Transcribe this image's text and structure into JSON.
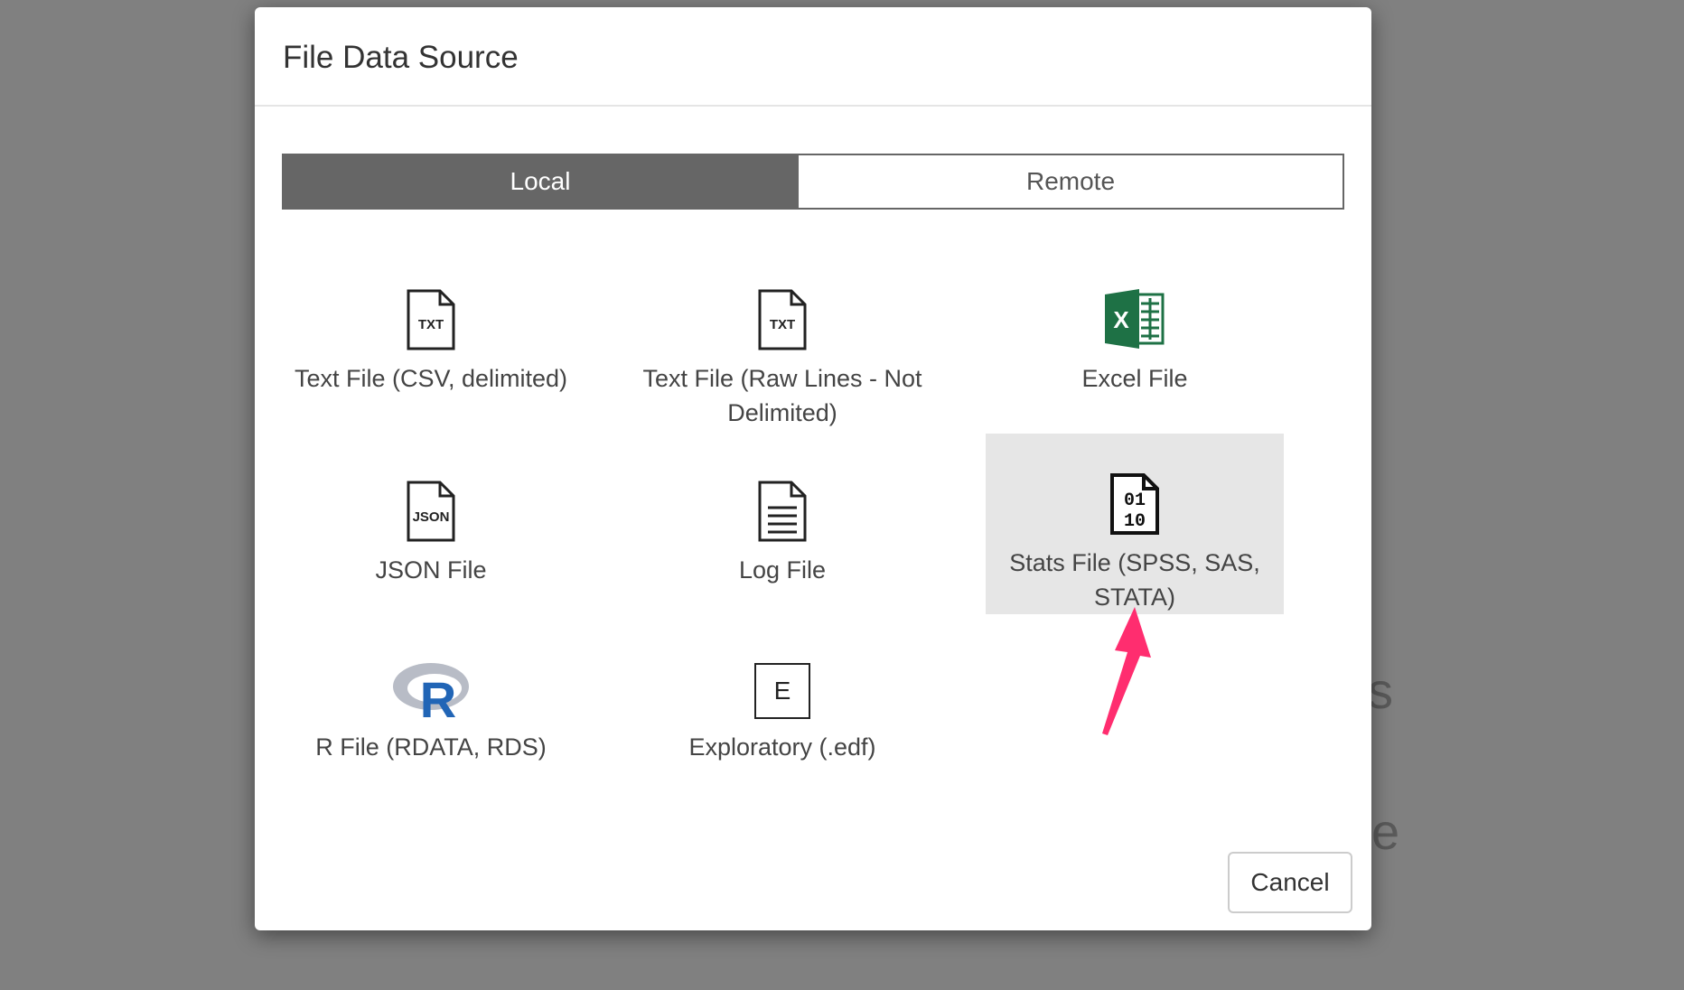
{
  "dialog": {
    "title": "File Data Source"
  },
  "tabs": [
    {
      "label": "Local",
      "active": true
    },
    {
      "label": "Remote",
      "active": false
    }
  ],
  "items": [
    {
      "label": "Text File (CSV, delimited)",
      "icon": "txt-file-icon"
    },
    {
      "label": "Text File (Raw Lines - Not Delimited)",
      "icon": "txt-file-icon"
    },
    {
      "label": "Excel File",
      "icon": "excel-icon"
    },
    {
      "label": "JSON File",
      "icon": "json-file-icon"
    },
    {
      "label": "Log File",
      "icon": "log-file-icon"
    },
    {
      "label": "Stats File (SPSS, SAS, STATA)",
      "icon": "binary-file-icon",
      "selected": true
    },
    {
      "label": "R File (RDATA, RDS)",
      "icon": "r-logo-icon"
    },
    {
      "label": "Exploratory (.edf)",
      "icon": "edf-icon",
      "icon_text": "E"
    }
  ],
  "buttons": {
    "cancel": "Cancel"
  },
  "background": {
    "partial_text_1": "s",
    "partial_text_2": "e"
  },
  "colors": {
    "active_tab": "#666666",
    "selected_item": "#e6e6e6",
    "excel_green": "#1e7145",
    "r_blue": "#2165b6",
    "annotation_arrow": "#ff2d6f"
  }
}
